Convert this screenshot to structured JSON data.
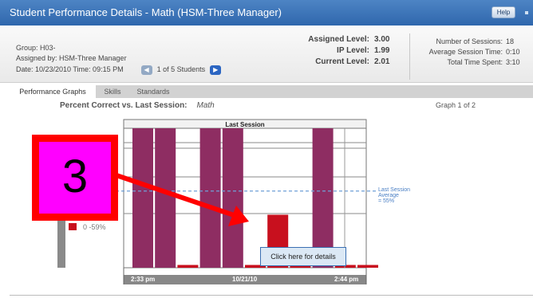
{
  "window": {
    "title": "Student Performance Details - Math (HSM-Three Manager)",
    "help_label": "Help"
  },
  "info": {
    "group": "Group: H03-",
    "assigned_by": "Assigned by: HSM-Three Manager",
    "date_time": "Date: 10/23/2010 Time: 09:15 PM",
    "students_nav": "1 of 5 Students",
    "prev_icon": "chevron-left-icon",
    "next_icon": "chevron-right-icon"
  },
  "levels": [
    {
      "label": "Assigned Level:",
      "value": "3.00"
    },
    {
      "label": "IP Level:",
      "value": "1.99"
    },
    {
      "label": "Current Level:",
      "value": "2.01"
    }
  ],
  "sessions": [
    {
      "label": "Number of Sessions:",
      "value": "18"
    },
    {
      "label": "Average Session Time:",
      "value": "0:10"
    },
    {
      "label": "Total Time Spent:",
      "value": "3:10"
    }
  ],
  "tabs": [
    {
      "label": "Performance Graphs",
      "active": true
    },
    {
      "label": "Skills",
      "active": false
    },
    {
      "label": "Standards",
      "active": false
    }
  ],
  "chart_header": {
    "title": "Percent Correct vs. Last Session:",
    "subject": "Math",
    "graph_counter": "Graph 1 of 2"
  },
  "chart_data": {
    "type": "bar",
    "title": "Last Session",
    "xlabel": "10/21/10",
    "x_start_label": "2:33 pm",
    "x_end_label": "2:44 pm",
    "ylim": [
      0,
      100
    ],
    "average_label_lines": [
      "Last Session",
      "Average",
      "= 55%"
    ],
    "average_value": 55,
    "legend": [
      {
        "label": "0 -59%",
        "color": "#c8101e"
      }
    ],
    "bars": [
      {
        "value": 100,
        "color": "#8e2d62"
      },
      {
        "value": 100,
        "color": "#8e2d62"
      },
      {
        "value": 2,
        "color": "#c8101e"
      },
      {
        "value": 100,
        "color": "#8e2d62"
      },
      {
        "value": 100,
        "color": "#8e2d62"
      },
      {
        "value": 2,
        "color": "#c8101e"
      },
      {
        "value": 38,
        "color": "#c8101e"
      },
      {
        "value": 2,
        "color": "#c8101e"
      },
      {
        "value": 100,
        "color": "#8e2d62"
      },
      {
        "value": 2,
        "color": "#c8101e"
      },
      {
        "value": 2,
        "color": "#c8101e"
      }
    ]
  },
  "tooltip": "Click here for details",
  "annotation": {
    "label": "3",
    "color": "#ff0000"
  }
}
